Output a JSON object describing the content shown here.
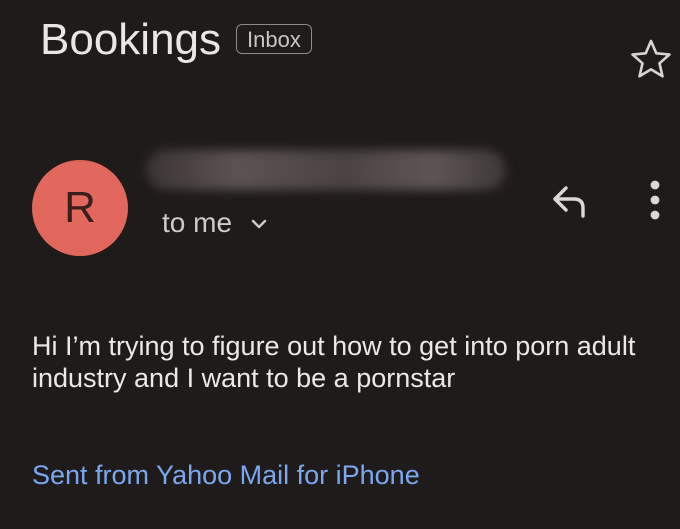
{
  "email": {
    "subject": "Bookings",
    "label": "Inbox",
    "sender_initial": "R",
    "sender_name": "",
    "recipient": "to me",
    "body": "Hi I’m trying to figure out how to get into porn adult industry and I want to be a pornstar",
    "signature": "Sent from Yahoo Mail for iPhone"
  },
  "icons": {
    "star": "star-outline-icon",
    "reply": "reply-icon",
    "more": "more-vertical-icon",
    "chevron": "chevron-down-icon"
  },
  "colors": {
    "background": "#1f1b1a",
    "avatar": "#e2685e",
    "link": "#7aa7f0"
  }
}
